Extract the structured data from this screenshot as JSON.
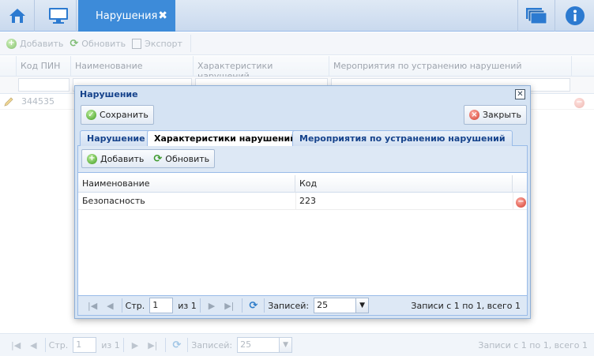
{
  "topbar": {
    "tab_label": "Нарушения",
    "tab_close": "✖"
  },
  "toolbar": {
    "add": "Добавить",
    "refresh": "Обновить",
    "export": "Экспорт"
  },
  "grid": {
    "columns": [
      "Код ПИН",
      "Наименование",
      "Характеристики нарушений",
      "Мероприятия по устранению нарушений"
    ],
    "rows": [
      {
        "pin": "344535"
      }
    ]
  },
  "pager": {
    "page_label": "Стр.",
    "page_value": "1",
    "of_label": "из 1",
    "records_label": "Записей:",
    "records_value": "25",
    "summary": "Записи с 1 по 1, всего 1"
  },
  "modal": {
    "title": "Нарушение",
    "close_glyph": "✕",
    "save": "Сохранить",
    "close": "Закрыть",
    "tabs": [
      {
        "label": "Нарушение"
      },
      {
        "label": "Характеристики нарушений"
      },
      {
        "label": "Мероприятия по устранению нарушений"
      }
    ],
    "inner_toolbar": {
      "add": "Добавить",
      "refresh": "Обновить"
    },
    "inner_grid": {
      "columns": [
        "Наименование",
        "Код"
      ],
      "rows": [
        {
          "name": "Безопасность",
          "code": "223"
        }
      ]
    },
    "pager": {
      "page_label": "Стр.",
      "page_value": "1",
      "of_label": "из 1",
      "records_label": "Записей:",
      "records_value": "25",
      "summary": "Записи с 1 по 1, всего 1"
    }
  }
}
